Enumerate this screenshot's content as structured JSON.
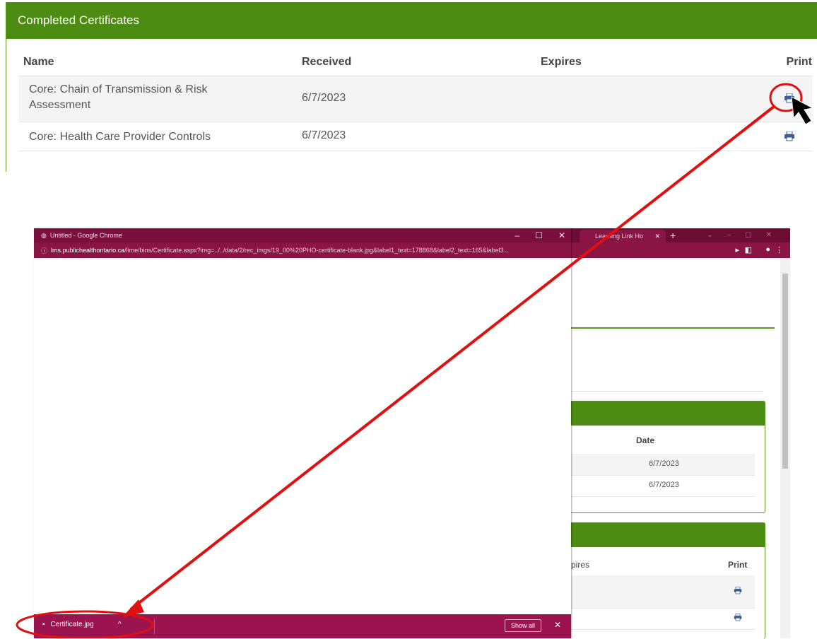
{
  "certificates": {
    "title": "Completed Certificates",
    "columns": {
      "name": "Name",
      "received": "Received",
      "expires": "Expires",
      "print": "Print"
    },
    "rows": [
      {
        "name": "Core: Chain of Transmission & Risk Assessment",
        "received": "6/7/2023",
        "expires": ""
      },
      {
        "name": "Core: Health Care Provider Controls",
        "received": "6/7/2023",
        "expires": ""
      }
    ]
  },
  "popup": {
    "window_title": "Untitled - Google Chrome",
    "url_domain": "lms.publichealthontario.ca",
    "url_path": "/lime/bins/Certificate.aspx?img=../../data/2/rec_imgs/19_00%20PHO-certificate-blank.jpg&label1_text=178868&label2_text=165&label3...",
    "download_file": "Certificate.jpg",
    "show_all_label": "Show all"
  },
  "background_browser": {
    "tab_title": "Learning Link Ho",
    "panel1": {
      "col": "Date",
      "values": [
        "6/7/2023",
        "6/7/2023"
      ]
    },
    "panel2": {
      "col_expires": "pires",
      "col_print": "Print"
    }
  },
  "colors": {
    "header_green": "#4d8c12",
    "browser_maroon": "#8a1444",
    "annotation_red": "#e01010"
  }
}
